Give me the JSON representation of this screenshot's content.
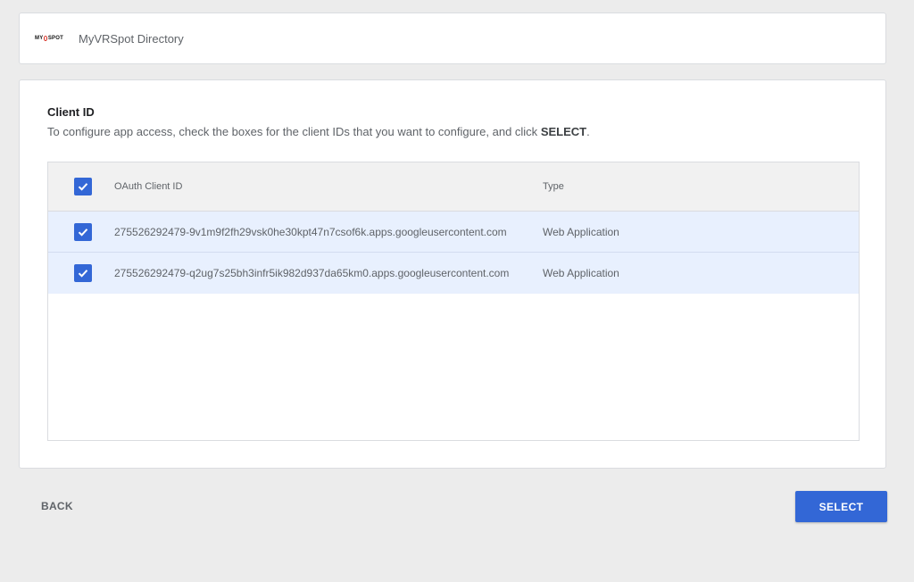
{
  "app": {
    "logo_text_left": "MY",
    "logo_text_right": "SPOT",
    "name": "MyVRSpot Directory"
  },
  "section": {
    "title": "Client ID",
    "description_prefix": "To configure app access, check the boxes for the client IDs that you want to configure, and click ",
    "description_bold": "SELECT",
    "description_suffix": "."
  },
  "table": {
    "header_checked": true,
    "columns": [
      "OAuth Client ID",
      "Type"
    ],
    "rows": [
      {
        "checked": true,
        "client_id": "275526292479-9v1m9f2fh29vsk0he30kpt47n7csof6k.apps.googleusercontent.com",
        "type": "Web Application"
      },
      {
        "checked": true,
        "client_id": "275526292479-q2ug7s25bh3infr5ik982d937da65km0.apps.googleusercontent.com",
        "type": "Web Application"
      }
    ]
  },
  "actions": {
    "back_label": "BACK",
    "select_label": "SELECT"
  },
  "colors": {
    "accent": "#3367d6",
    "row_selected": "#e8f0fe",
    "background": "#ececec"
  }
}
